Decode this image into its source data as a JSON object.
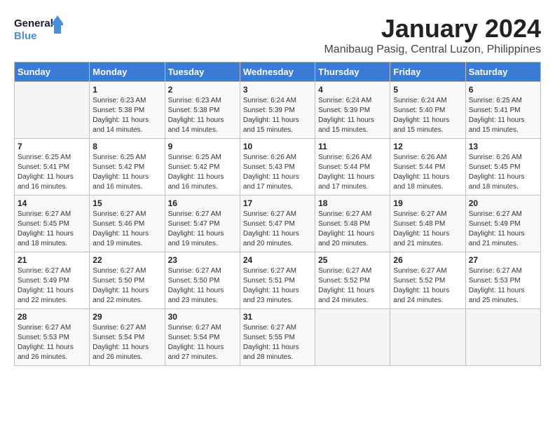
{
  "logo": {
    "line1": "General",
    "line2": "Blue"
  },
  "title": "January 2024",
  "location": "Manibaug Pasig, Central Luzon, Philippines",
  "days_of_week": [
    "Sunday",
    "Monday",
    "Tuesday",
    "Wednesday",
    "Thursday",
    "Friday",
    "Saturday"
  ],
  "weeks": [
    [
      {
        "day": "",
        "content": ""
      },
      {
        "day": "1",
        "content": "Sunrise: 6:23 AM\nSunset: 5:38 PM\nDaylight: 11 hours\nand 14 minutes."
      },
      {
        "day": "2",
        "content": "Sunrise: 6:23 AM\nSunset: 5:38 PM\nDaylight: 11 hours\nand 14 minutes."
      },
      {
        "day": "3",
        "content": "Sunrise: 6:24 AM\nSunset: 5:39 PM\nDaylight: 11 hours\nand 15 minutes."
      },
      {
        "day": "4",
        "content": "Sunrise: 6:24 AM\nSunset: 5:39 PM\nDaylight: 11 hours\nand 15 minutes."
      },
      {
        "day": "5",
        "content": "Sunrise: 6:24 AM\nSunset: 5:40 PM\nDaylight: 11 hours\nand 15 minutes."
      },
      {
        "day": "6",
        "content": "Sunrise: 6:25 AM\nSunset: 5:41 PM\nDaylight: 11 hours\nand 15 minutes."
      }
    ],
    [
      {
        "day": "7",
        "content": "Sunrise: 6:25 AM\nSunset: 5:41 PM\nDaylight: 11 hours\nand 16 minutes."
      },
      {
        "day": "8",
        "content": "Sunrise: 6:25 AM\nSunset: 5:42 PM\nDaylight: 11 hours\nand 16 minutes."
      },
      {
        "day": "9",
        "content": "Sunrise: 6:25 AM\nSunset: 5:42 PM\nDaylight: 11 hours\nand 16 minutes."
      },
      {
        "day": "10",
        "content": "Sunrise: 6:26 AM\nSunset: 5:43 PM\nDaylight: 11 hours\nand 17 minutes."
      },
      {
        "day": "11",
        "content": "Sunrise: 6:26 AM\nSunset: 5:44 PM\nDaylight: 11 hours\nand 17 minutes."
      },
      {
        "day": "12",
        "content": "Sunrise: 6:26 AM\nSunset: 5:44 PM\nDaylight: 11 hours\nand 18 minutes."
      },
      {
        "day": "13",
        "content": "Sunrise: 6:26 AM\nSunset: 5:45 PM\nDaylight: 11 hours\nand 18 minutes."
      }
    ],
    [
      {
        "day": "14",
        "content": "Sunrise: 6:27 AM\nSunset: 5:45 PM\nDaylight: 11 hours\nand 18 minutes."
      },
      {
        "day": "15",
        "content": "Sunrise: 6:27 AM\nSunset: 5:46 PM\nDaylight: 11 hours\nand 19 minutes."
      },
      {
        "day": "16",
        "content": "Sunrise: 6:27 AM\nSunset: 5:47 PM\nDaylight: 11 hours\nand 19 minutes."
      },
      {
        "day": "17",
        "content": "Sunrise: 6:27 AM\nSunset: 5:47 PM\nDaylight: 11 hours\nand 20 minutes."
      },
      {
        "day": "18",
        "content": "Sunrise: 6:27 AM\nSunset: 5:48 PM\nDaylight: 11 hours\nand 20 minutes."
      },
      {
        "day": "19",
        "content": "Sunrise: 6:27 AM\nSunset: 5:48 PM\nDaylight: 11 hours\nand 21 minutes."
      },
      {
        "day": "20",
        "content": "Sunrise: 6:27 AM\nSunset: 5:49 PM\nDaylight: 11 hours\nand 21 minutes."
      }
    ],
    [
      {
        "day": "21",
        "content": "Sunrise: 6:27 AM\nSunset: 5:49 PM\nDaylight: 11 hours\nand 22 minutes."
      },
      {
        "day": "22",
        "content": "Sunrise: 6:27 AM\nSunset: 5:50 PM\nDaylight: 11 hours\nand 22 minutes."
      },
      {
        "day": "23",
        "content": "Sunrise: 6:27 AM\nSunset: 5:50 PM\nDaylight: 11 hours\nand 23 minutes."
      },
      {
        "day": "24",
        "content": "Sunrise: 6:27 AM\nSunset: 5:51 PM\nDaylight: 11 hours\nand 23 minutes."
      },
      {
        "day": "25",
        "content": "Sunrise: 6:27 AM\nSunset: 5:52 PM\nDaylight: 11 hours\nand 24 minutes."
      },
      {
        "day": "26",
        "content": "Sunrise: 6:27 AM\nSunset: 5:52 PM\nDaylight: 11 hours\nand 24 minutes."
      },
      {
        "day": "27",
        "content": "Sunrise: 6:27 AM\nSunset: 5:53 PM\nDaylight: 11 hours\nand 25 minutes."
      }
    ],
    [
      {
        "day": "28",
        "content": "Sunrise: 6:27 AM\nSunset: 5:53 PM\nDaylight: 11 hours\nand 26 minutes."
      },
      {
        "day": "29",
        "content": "Sunrise: 6:27 AM\nSunset: 5:54 PM\nDaylight: 11 hours\nand 26 minutes."
      },
      {
        "day": "30",
        "content": "Sunrise: 6:27 AM\nSunset: 5:54 PM\nDaylight: 11 hours\nand 27 minutes."
      },
      {
        "day": "31",
        "content": "Sunrise: 6:27 AM\nSunset: 5:55 PM\nDaylight: 11 hours\nand 28 minutes."
      },
      {
        "day": "",
        "content": ""
      },
      {
        "day": "",
        "content": ""
      },
      {
        "day": "",
        "content": ""
      }
    ]
  ]
}
